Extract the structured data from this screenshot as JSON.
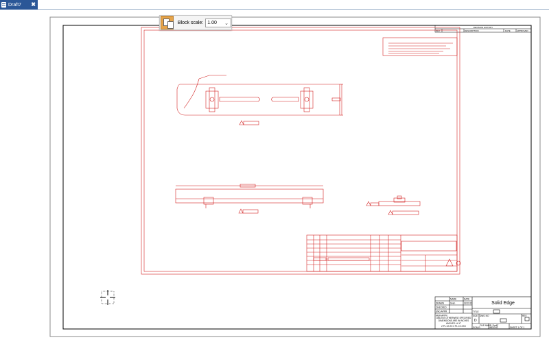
{
  "tab": {
    "title": "Draft7",
    "close_icon": "close-icon"
  },
  "toolbar": {
    "scale_label": "Block scale:",
    "scale_value": "1.00"
  },
  "titleblock": {
    "brand": "Solid Edge",
    "tolerance_note_1": "UNLESS OTHERWISE SPECIFIED",
    "tolerance_note_2": "DIMENSIONS ARE IN INCHES",
    "tolerance_note_3": "ANGLES ±X.X°",
    "tolerance_note_4": "2 PL ±X.XX  3 PL ±X.XXX",
    "name_header": "NAME",
    "date_header": "DATE",
    "row_drawn": "DRAWN",
    "row_checked": "CHECKED",
    "row_eng": "ENG APPR",
    "row_mgr": "MGR APPR",
    "drawn_name": "Sven",
    "drawn_date": "02/11/16",
    "title_label": "TITLE",
    "size_label": "SIZE",
    "size_value": "D",
    "dwg_label": "DWG NO",
    "rev_label": "REV",
    "file_label": "FILE NAME: Draft7",
    "scale_label": "SCALE:",
    "weight_label": "WEIGHT:",
    "sheet_label": "SHEET 1 OF 1"
  },
  "revision": {
    "title": "REVISION HISTORY",
    "col_rev": "REV",
    "col_desc": "DESCRIPTION",
    "col_date": "DATE",
    "col_approved": "APPROVED"
  },
  "colors": {
    "sheet_border": "#000000",
    "block_red": "#d22020",
    "tab_blue": "#2b5797"
  }
}
